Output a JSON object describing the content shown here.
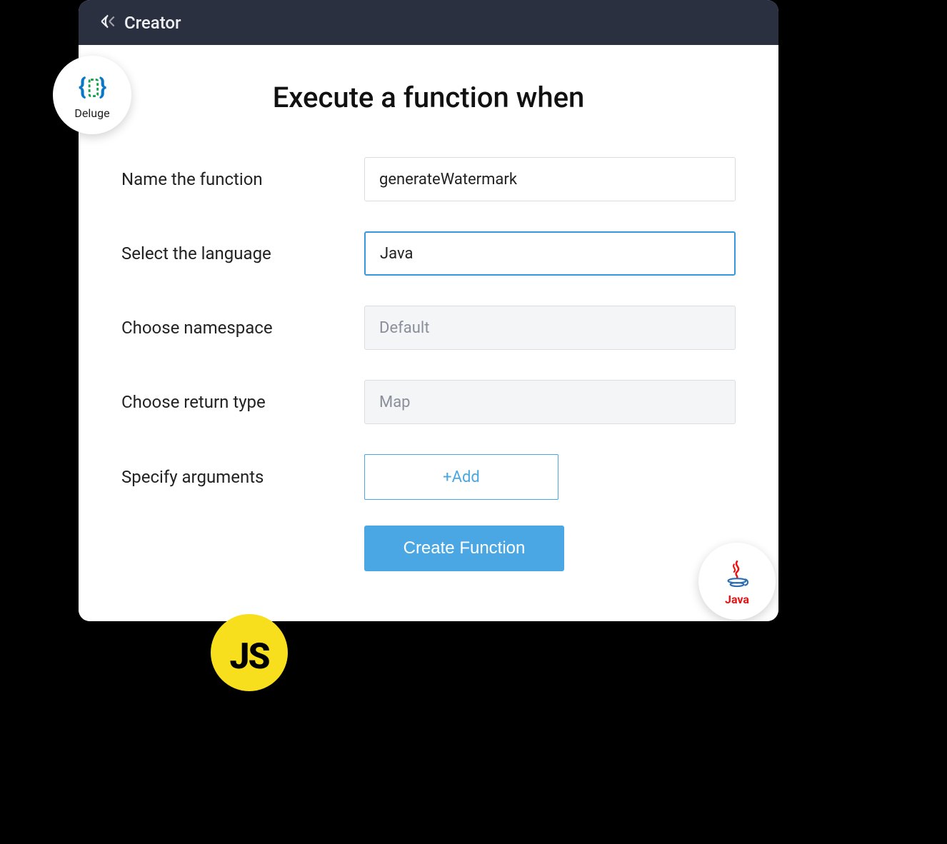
{
  "titlebar": {
    "title": "Creator"
  },
  "page": {
    "heading": "Execute a function when"
  },
  "form": {
    "name": {
      "label": "Name the function",
      "value": "generateWatermark"
    },
    "language": {
      "label": "Select the language",
      "value": "Java"
    },
    "namespace": {
      "label": "Choose namespace",
      "value": "Default"
    },
    "return_type": {
      "label": "Choose return type",
      "value": "Map"
    },
    "arguments": {
      "label": "Specify arguments",
      "add_label": "+Add"
    },
    "submit_label": "Create Function"
  },
  "badges": {
    "deluge": {
      "label": "Deluge",
      "icon": "deluge-icon"
    },
    "js": {
      "label": "JS",
      "icon": "js-icon"
    },
    "java": {
      "label": "Java",
      "icon": "java-icon"
    }
  },
  "colors": {
    "accent": "#4aa7e3",
    "titlebar_bg": "#2a3040",
    "js_yellow": "#f7df1e"
  }
}
